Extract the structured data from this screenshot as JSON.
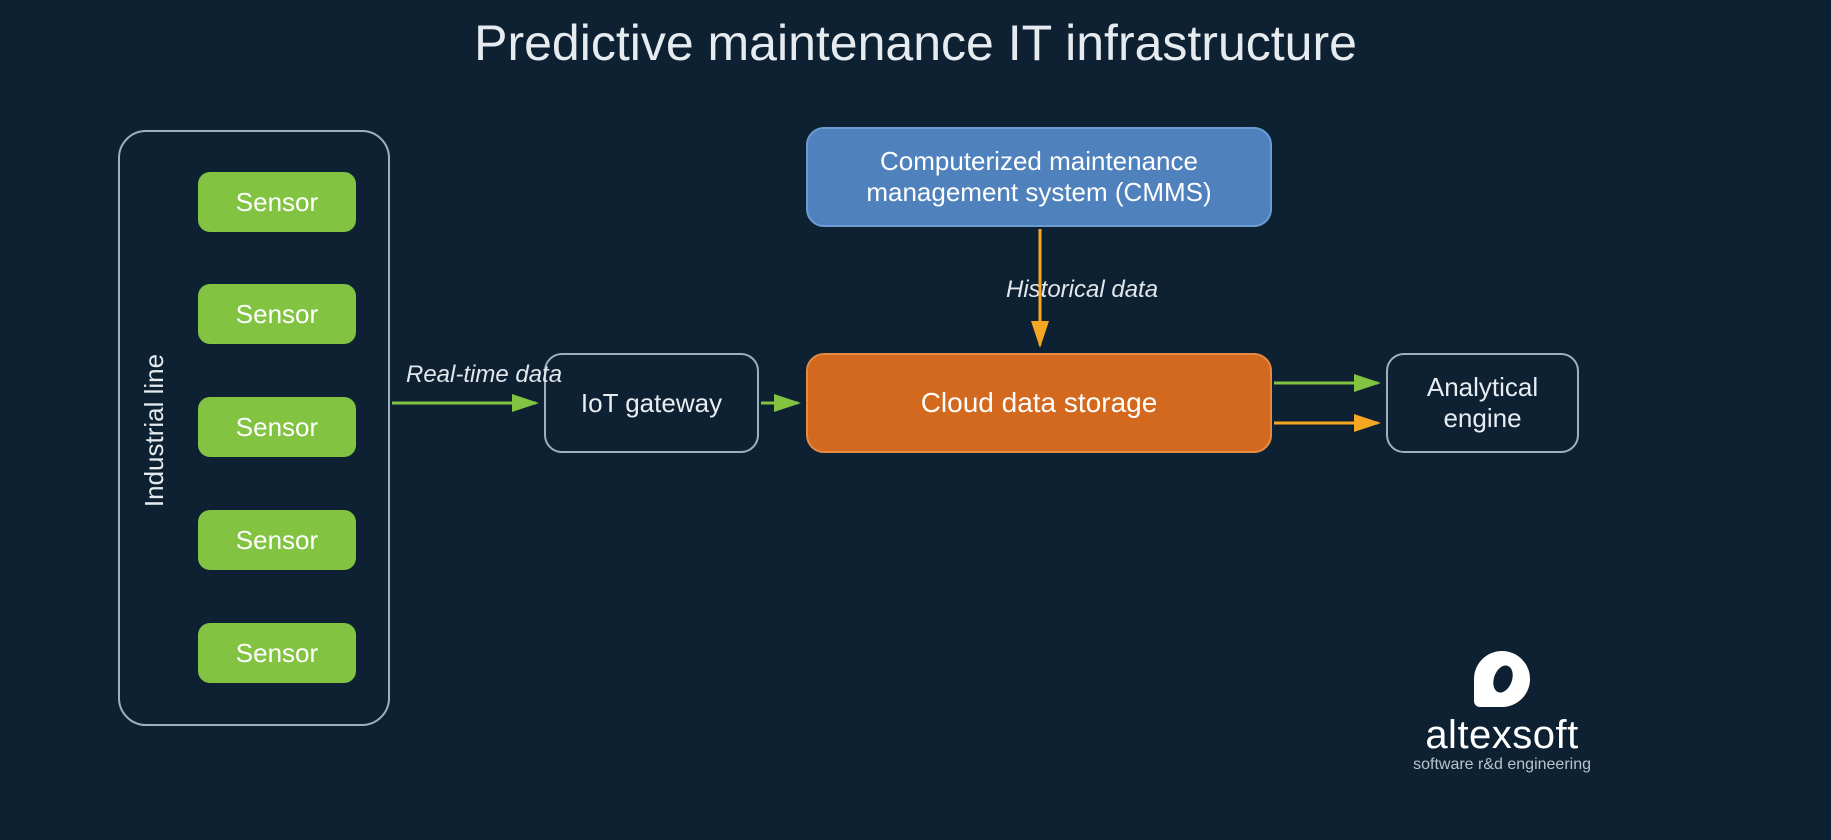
{
  "title": "Predictive maintenance IT infrastructure",
  "industrial_line": {
    "label": "Industrial line",
    "sensors": [
      "Sensor",
      "Sensor",
      "Sensor",
      "Sensor",
      "Sensor"
    ]
  },
  "nodes": {
    "iot_gateway": "IoT gateway",
    "cmms_line1": "Computerized maintenance",
    "cmms_line2": "management system (CMMS)",
    "cloud_storage": "Cloud data storage",
    "engine_line1": "Analytical",
    "engine_line2": "engine"
  },
  "flow_labels": {
    "realtime": "Real-time data",
    "historical": "Historical data"
  },
  "logo": {
    "name": "altexsoft",
    "tagline": "software r&d engineering"
  },
  "colors": {
    "bg": "#0e2133",
    "sensor": "#82c341",
    "cmms": "#4f81bd",
    "cloud": "#d2691e",
    "arrow_green": "#82c341",
    "arrow_amber": "#f5a623"
  }
}
